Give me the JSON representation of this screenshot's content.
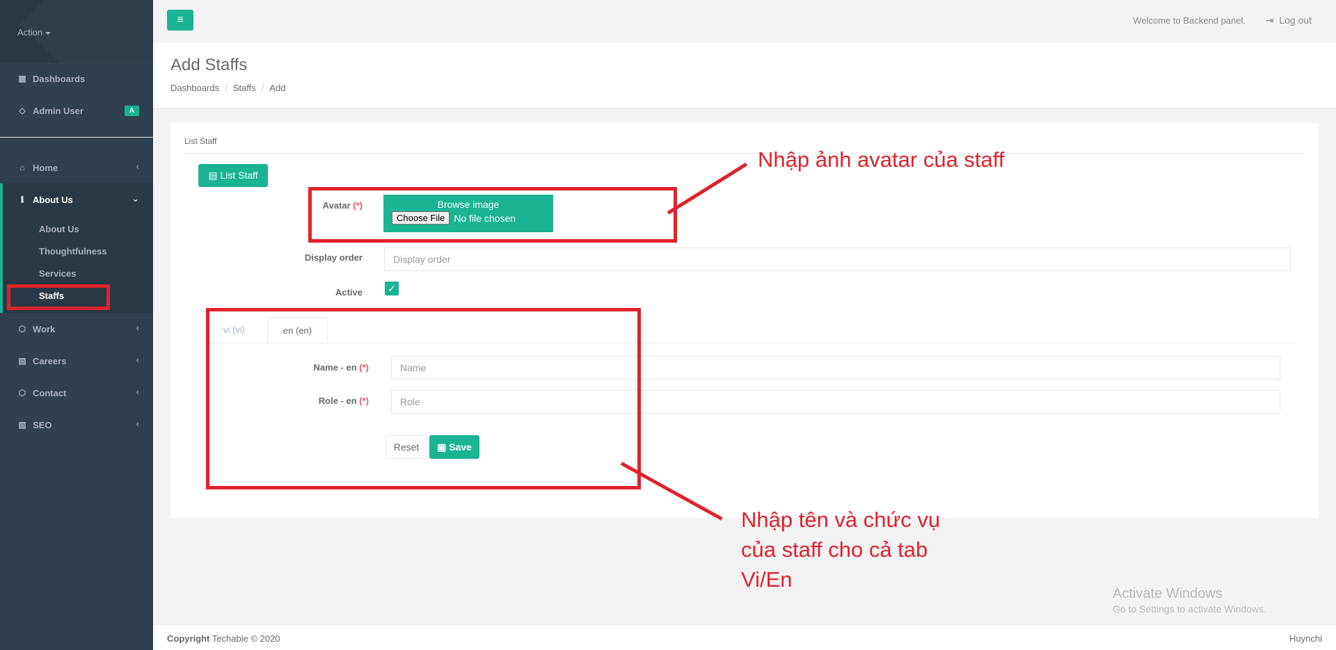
{
  "sidebar": {
    "action_label": "Action",
    "top_items": [
      {
        "label": "Dashboards"
      },
      {
        "label": "Admin User",
        "badge": "A"
      }
    ],
    "menu": [
      {
        "label": "Home"
      },
      {
        "label": "About Us"
      },
      {
        "label": "Work"
      },
      {
        "label": "Careers"
      },
      {
        "label": "Contact"
      },
      {
        "label": "SEO"
      }
    ],
    "submenu": [
      {
        "label": "About Us"
      },
      {
        "label": "Thoughtfulness"
      },
      {
        "label": "Services"
      },
      {
        "label": "Staffs"
      }
    ]
  },
  "topbar": {
    "welcome": "Welcome to Backend panel.",
    "logout": "Log out"
  },
  "page": {
    "title": "Add Staffs",
    "breadcrumb": [
      "Dashboards",
      "Staffs",
      "Add"
    ]
  },
  "panel": {
    "title": "List Staff",
    "list_button": "List Staff",
    "avatar_label": "Avatar",
    "required_mark": "(*)",
    "browse_text": "Browse image",
    "choose_file": "Choose File",
    "no_file": "No file chosen",
    "display_order_label": "Display order",
    "display_order_placeholder": "Display order",
    "active_label": "Active",
    "active_checked": true,
    "tabs": [
      "vi (vi)",
      "en (en)"
    ],
    "active_tab": "en (en)",
    "name_label": "Name - en",
    "name_placeholder": "Name",
    "role_label": "Role - en",
    "role_placeholder": "Role",
    "reset_button": "Reset",
    "save_button": "Save"
  },
  "annotations": {
    "avatar_note": "Nhập ảnh avatar của staff",
    "tabs_note_line1": "Nhập tên và chức vụ",
    "tabs_note_line2": "của staff cho cả tab",
    "tabs_note_line3": "Vi/En",
    "highlight_color": "#e0222b"
  },
  "windows_watermark": {
    "title": "Activate Windows",
    "subtitle": "Go to Settings to activate Windows."
  },
  "footer": {
    "copyright_bold": "Copyright",
    "copyright_text": "Techable © 2020",
    "right": "Huynchi"
  },
  "colors": {
    "sidebar_bg": "#2f4050",
    "accent": "#1ab394"
  }
}
